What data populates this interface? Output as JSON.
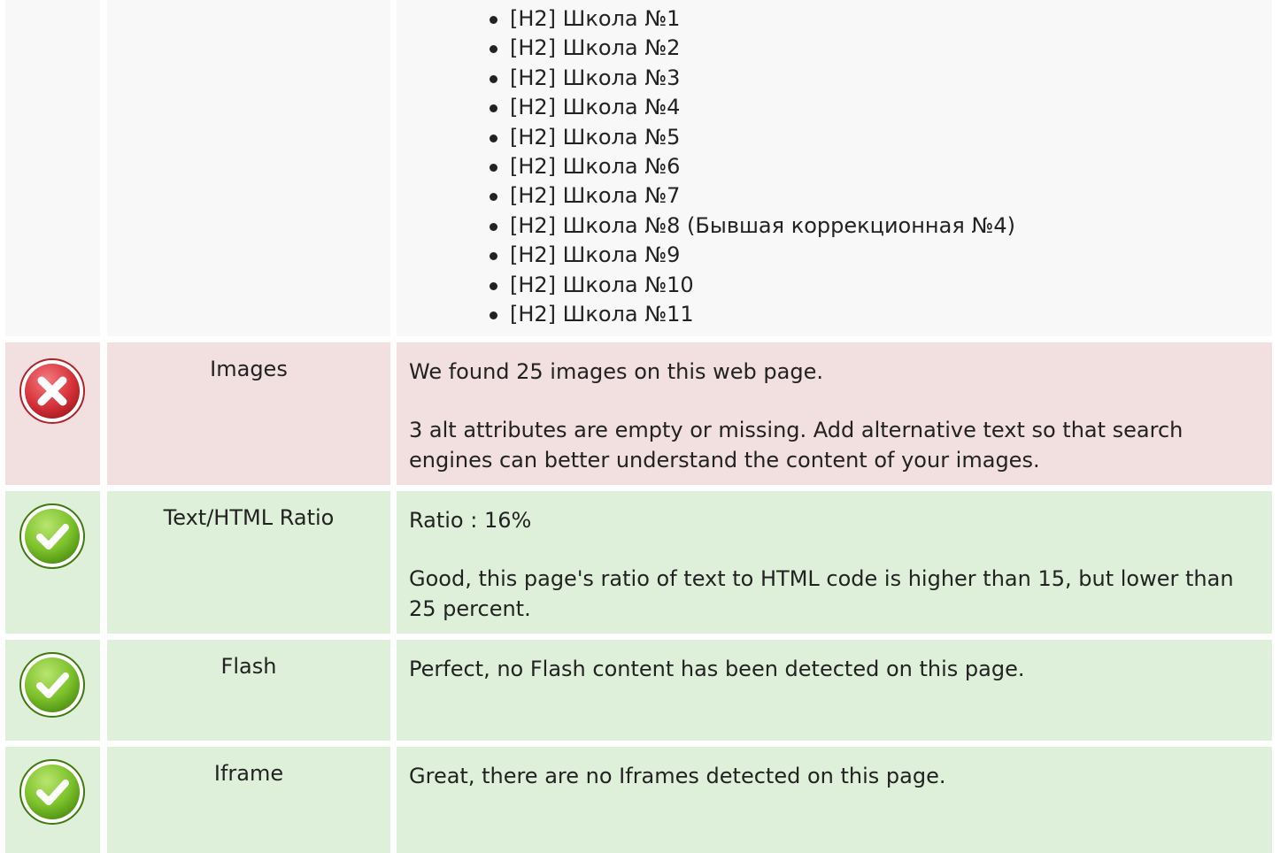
{
  "headings": {
    "items": [
      "[H2] Школа №1",
      "[H2] Школа №2",
      "[H2] Школа №3",
      "[H2] Школа №4",
      "[H2] Школа №5",
      "[H2] Школа №6",
      "[H2] Школа №7",
      "[H2] Школа №8 (Бывшая коррекционная №4)",
      "[H2] Школа №9",
      "[H2] Школа №10",
      "[H2] Школа №11"
    ]
  },
  "checks": [
    {
      "status": "error",
      "icon": "error-x-icon",
      "name": "Images",
      "paragraphs": [
        "We found 25 images on this web page.",
        "3 alt attributes are empty or missing. Add alternative text so that search engines can better understand the content of your images."
      ]
    },
    {
      "status": "pass",
      "icon": "check-icon",
      "name": "Text/HTML Ratio",
      "paragraphs": [
        "Ratio : 16%",
        "Good, this page's ratio of text to HTML code is higher than 15, but lower than 25 percent."
      ]
    },
    {
      "status": "pass",
      "icon": "check-icon",
      "name": "Flash",
      "paragraphs": [
        "Perfect, no Flash content has been detected on this page."
      ]
    },
    {
      "status": "pass",
      "icon": "check-icon",
      "name": "Iframe",
      "paragraphs": [
        "Great, there are no Iframes detected on this page."
      ]
    }
  ],
  "colors": {
    "neutral_bg": "#f8f8f8",
    "error_bg": "#f2dfe0",
    "pass_bg": "#dff0da",
    "error_icon": "#d9363e",
    "pass_icon": "#7dc22c"
  }
}
